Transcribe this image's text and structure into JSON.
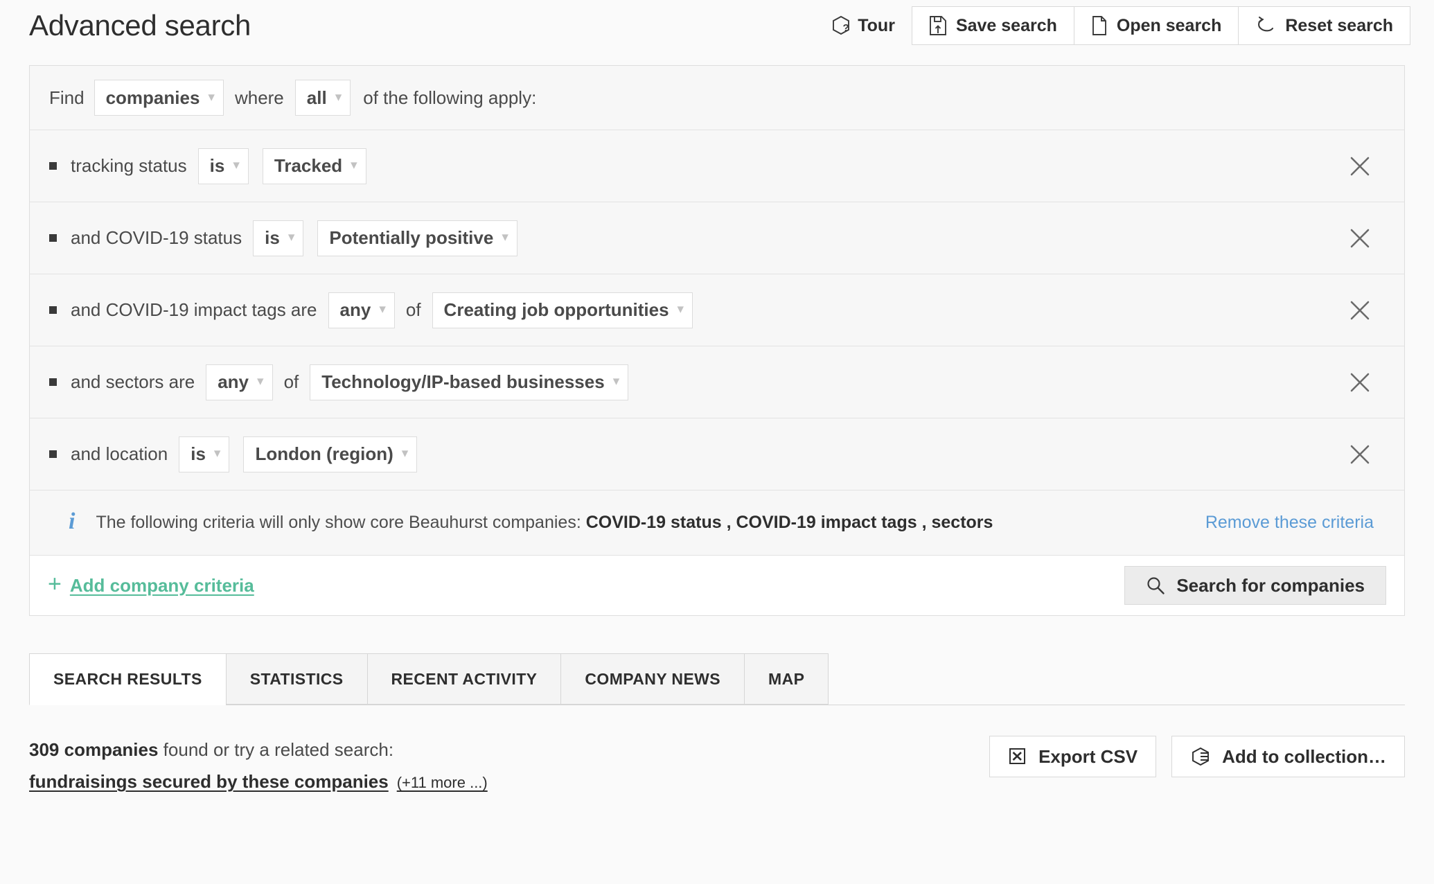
{
  "page": {
    "title": "Advanced search"
  },
  "header": {
    "tour_label": "Tour",
    "save_label": "Save search",
    "open_label": "Open search",
    "reset_label": "Reset search",
    "icons": {
      "tour": "hexagon-question-icon",
      "save": "save-document-icon",
      "open": "file-icon",
      "reset": "undo-arrow-icon"
    }
  },
  "query": {
    "find": {
      "prefix": "Find",
      "entity_value": "companies",
      "middle": "where",
      "match_value": "all",
      "suffix": "of the following apply:"
    },
    "criteria": [
      {
        "label": "tracking status",
        "operator": "is",
        "value": "Tracked",
        "has_of": false
      },
      {
        "label": "and COVID-19 status",
        "operator": "is",
        "value": "Potentially positive",
        "has_of": false
      },
      {
        "label": "and COVID-19 impact tags are",
        "operator": "any",
        "of_label": "of",
        "value": "Creating job opportunities",
        "has_of": true
      },
      {
        "label": "and sectors are",
        "operator": "any",
        "of_label": "of",
        "value": "Technology/IP-based businesses",
        "has_of": true
      },
      {
        "label": "and location",
        "operator": "is",
        "value": "London (region)",
        "has_of": false
      }
    ],
    "notice": {
      "text_lead": "The following criteria will only show core Beauhurst companies:",
      "text_bold": "COVID-19 status , COVID-19 impact tags , sectors",
      "remove_label": "Remove these criteria",
      "icon": "info-icon"
    },
    "add_criteria_label": "Add company criteria",
    "search_button_label": "Search for companies"
  },
  "tabs": [
    {
      "label": "SEARCH RESULTS",
      "active": true
    },
    {
      "label": "STATISTICS",
      "active": false
    },
    {
      "label": "RECENT ACTIVITY",
      "active": false
    },
    {
      "label": "COMPANY NEWS",
      "active": false
    },
    {
      "label": "MAP",
      "active": false
    }
  ],
  "results": {
    "count_text": "309 companies",
    "found_text": "found or try a related search:",
    "related_link": "fundraisings secured by these companies",
    "more_link": "(+11 more ...)",
    "export_label": "Export CSV",
    "collection_label": "Add to collection…"
  },
  "colors": {
    "accent_green": "#56bc9a",
    "link_blue": "#5b9bd5",
    "page_bg": "#fafafa",
    "panel_bg": "#f7f7f7",
    "border": "#dedede"
  }
}
